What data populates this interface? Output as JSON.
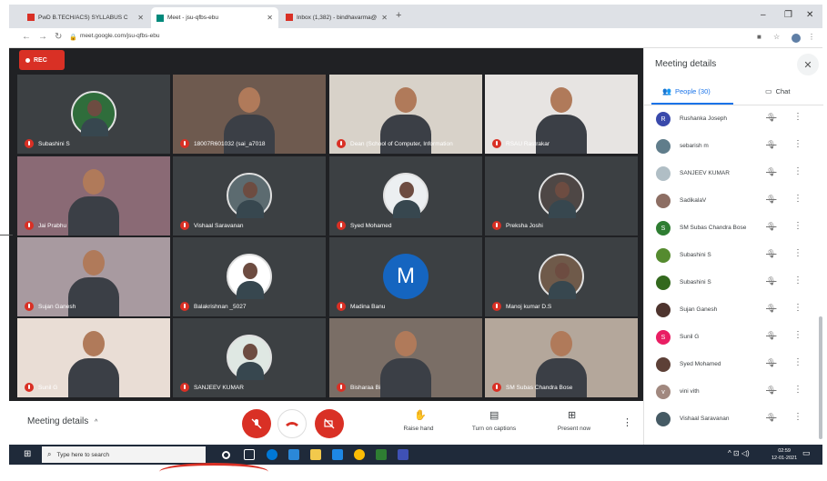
{
  "browser": {
    "tabs": [
      {
        "label": "PwD B.TECH/ACS) SYLLABUS C",
        "color": "#d93025"
      },
      {
        "label": "Meet - jsu-qfbs-ebu",
        "color": "#00897b"
      },
      {
        "label": "Inbox (1,382) - bindhavarma@",
        "color": "#d93025"
      }
    ],
    "new_tab": "+",
    "url": "meet.google.com/jsu-qfbs-ebu",
    "min": "–",
    "max": "❐",
    "close": "✕"
  },
  "meet": {
    "rec_label": "REC",
    "tiles": [
      {
        "name": "Subashini S",
        "bg": "#3c4043",
        "kind": "avatar",
        "color": "#2f6d3b"
      },
      {
        "name": "18007R601032 (sai_a7018",
        "bg": "#6e5a4f",
        "kind": "video"
      },
      {
        "name": "Dean (School of Computer, Information",
        "bg": "#d8d2c9",
        "kind": "video"
      },
      {
        "name": "RSAU Rastrakar",
        "bg": "#e7e4e2",
        "kind": "video"
      },
      {
        "name": "Jai Prabhu",
        "bg": "#8a6a75",
        "kind": "video"
      },
      {
        "name": "Vishaal Saravanan",
        "bg": "#3c4043",
        "kind": "avatar",
        "color": "#5c6b70"
      },
      {
        "name": "Syed Mohamed",
        "bg": "#3c4043",
        "kind": "avatar",
        "color": "#eceff1"
      },
      {
        "name": "Preksha Joshi",
        "bg": "#3c4043",
        "kind": "avatar",
        "color": "#4e4745"
      },
      {
        "name": "Sujan Ganesh",
        "bg": "#a89aa0",
        "kind": "video"
      },
      {
        "name": "Balakrishnan _5027",
        "bg": "#3c4043",
        "kind": "avatar",
        "color": "#ffffff"
      },
      {
        "name": "Madina Banu",
        "bg": "#3c4043",
        "kind": "letter",
        "letter": "M",
        "color": "#1565c0"
      },
      {
        "name": "Manoj kumar D.S",
        "bg": "#3c4043",
        "kind": "avatar",
        "color": "#6f5a4a"
      },
      {
        "name": "Sunil G",
        "bg": "#e9ddd5",
        "kind": "video"
      },
      {
        "name": "SANJEEV KUMAR",
        "bg": "#3c4043",
        "kind": "avatar",
        "color": "#dfe8e3"
      },
      {
        "name": "Bisharaa Bi",
        "bg": "#7a6e66",
        "kind": "video"
      },
      {
        "name": "SM Subas Chandra Bose",
        "bg": "#b4a79b",
        "kind": "video"
      }
    ]
  },
  "controls": {
    "meeting_details": "Meeting details",
    "meeting_details_chevron": "^",
    "raise_hand": "Raise hand",
    "captions": "Turn on captions",
    "present": "Present now"
  },
  "panel": {
    "title": "Meeting details",
    "people_tab": "People (30)",
    "chat_tab": "Chat",
    "participants": [
      {
        "name": "Rushanka Joseph",
        "initial": "R",
        "color": "#3949ab"
      },
      {
        "name": "sebarish m",
        "initial": "",
        "color": "#607d8b"
      },
      {
        "name": "SANJEEV KUMAR",
        "initial": "",
        "color": "#b0bec5"
      },
      {
        "name": "SadikalaV",
        "initial": "",
        "color": "#8d6e63"
      },
      {
        "name": "SM Subas Chandra Bose",
        "initial": "S",
        "color": "#2e7d32"
      },
      {
        "name": "Subashini S",
        "initial": "",
        "color": "#558b2f"
      },
      {
        "name": "Subashini S",
        "initial": "",
        "color": "#33691e"
      },
      {
        "name": "Sujan Ganesh",
        "initial": "",
        "color": "#4e342e"
      },
      {
        "name": "Sunil G",
        "initial": "S",
        "color": "#e91e63"
      },
      {
        "name": "Syed Mohamed",
        "initial": "",
        "color": "#5d4037"
      },
      {
        "name": "vini vith",
        "initial": "v",
        "color": "#a1887f"
      },
      {
        "name": "Vishaal Saravanan",
        "initial": "",
        "color": "#455a64"
      }
    ]
  },
  "taskbar": {
    "search_placeholder": "Type here to search",
    "time": "02:59",
    "date": "12-01-2021"
  }
}
